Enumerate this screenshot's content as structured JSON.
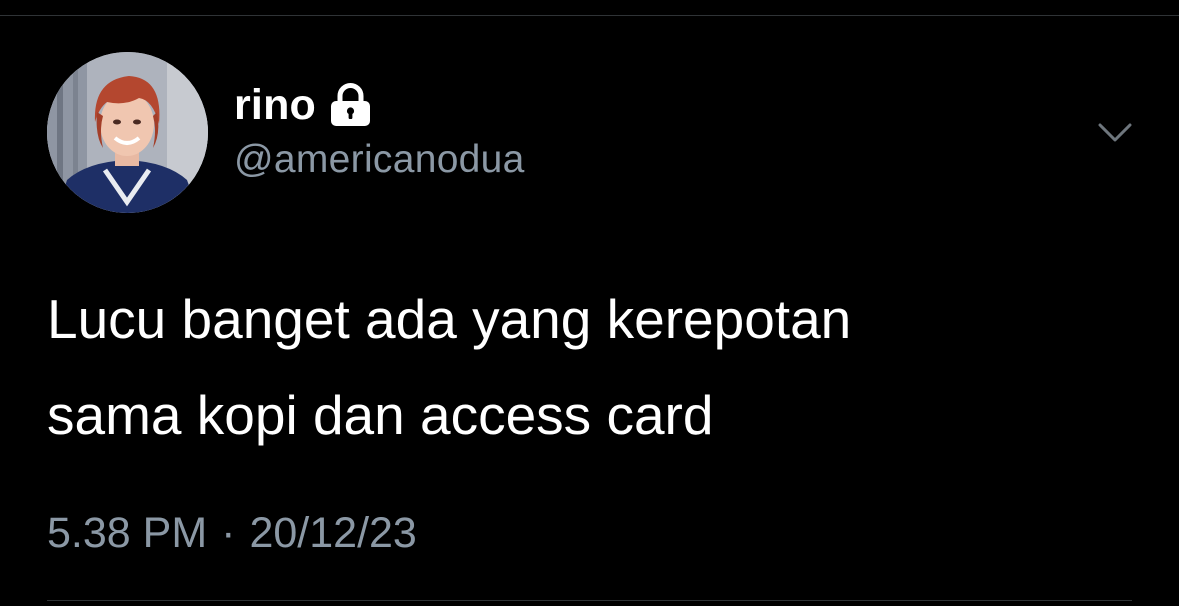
{
  "tweet": {
    "author": {
      "display_name": "rino",
      "handle": "@americanodua",
      "protected": true,
      "avatar_icon": "profile-photo",
      "lock_icon": "lock-icon"
    },
    "text_lines": [
      "Lucu banget ada yang kerepotan",
      "sama kopi dan access card"
    ],
    "time": "5.38 PM",
    "separator": "·",
    "date": "20/12/23",
    "menu_icon": "chevron-down-icon"
  },
  "colors": {
    "background": "#000000",
    "primary_text": "#ffffff",
    "secondary_text": "#8b98a5",
    "divider": "#2f3336"
  }
}
